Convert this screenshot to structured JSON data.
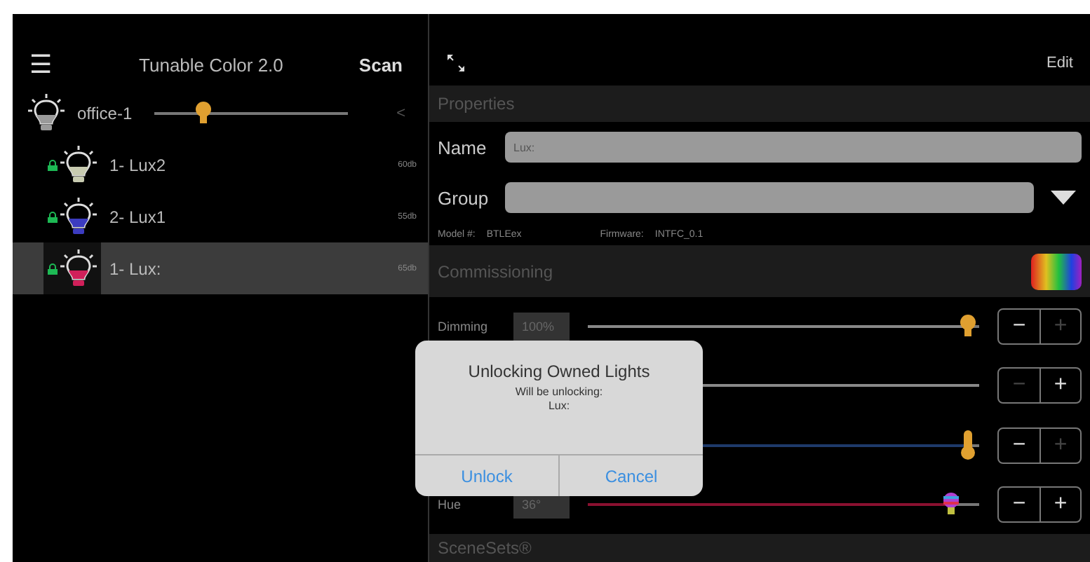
{
  "sidebar": {
    "menu_icon": "☰",
    "title": "Tunable Color 2.0",
    "scan": "Scan",
    "groups": [
      {
        "name": "office-1",
        "level": 0.25,
        "collapse": "<",
        "color": "#9a9a9a",
        "children": [
          {
            "name": "1- Lux2",
            "signal": "60db",
            "locked": true,
            "selected": false,
            "color": "#c8cbb0"
          },
          {
            "name": "2- Lux1",
            "signal": "55db",
            "locked": true,
            "selected": false,
            "color": "#3c3cc0"
          },
          {
            "name": "1- Lux:",
            "signal": "65db",
            "locked": true,
            "selected": true,
            "color": "#d0205a"
          }
        ]
      }
    ]
  },
  "detail": {
    "edit": "Edit",
    "properties_header": "Properties",
    "fields": [
      {
        "label": "Name",
        "value": "Lux:",
        "kind": "text"
      },
      {
        "label": "Group",
        "kind": "dropdown"
      }
    ],
    "model_label": "Model #:",
    "model": "BTLEex",
    "firmware_label": "Firmware:",
    "firmware": "INTFC_0.1",
    "commissioning_header": "Commissioning",
    "sliders": [
      {
        "label": "Dimming",
        "value": "100%",
        "level": 0.97,
        "kind": "bulb",
        "color": "#888888",
        "buttons": [
          {
            "label": "−",
            "disabled": false
          },
          {
            "label": "+",
            "disabled": true
          }
        ]
      },
      {
        "color": "#888888",
        "buttons": [
          {
            "label": "−",
            "disabled": true
          },
          {
            "label": "+",
            "disabled": false
          }
        ]
      },
      {
        "level": 0.97,
        "kind": "thermometer",
        "color": "#1e3a6a",
        "buttons": [
          {
            "label": "−",
            "disabled": false
          },
          {
            "label": "+",
            "disabled": true
          }
        ]
      },
      {
        "label": "Hue",
        "value": "36°",
        "level": 0.93,
        "kind": "rainbow",
        "color": "#8a1030",
        "buttons": [
          {
            "label": "−",
            "disabled": false
          },
          {
            "label": "+",
            "disabled": false
          }
        ]
      }
    ],
    "scenesets_header": "SceneSets®"
  },
  "dialog": {
    "title": "Unlocking Owned Lights",
    "message": [
      "Will be unlocking:",
      "Lux:"
    ],
    "buttons": [
      "Unlock",
      "Cancel"
    ]
  }
}
